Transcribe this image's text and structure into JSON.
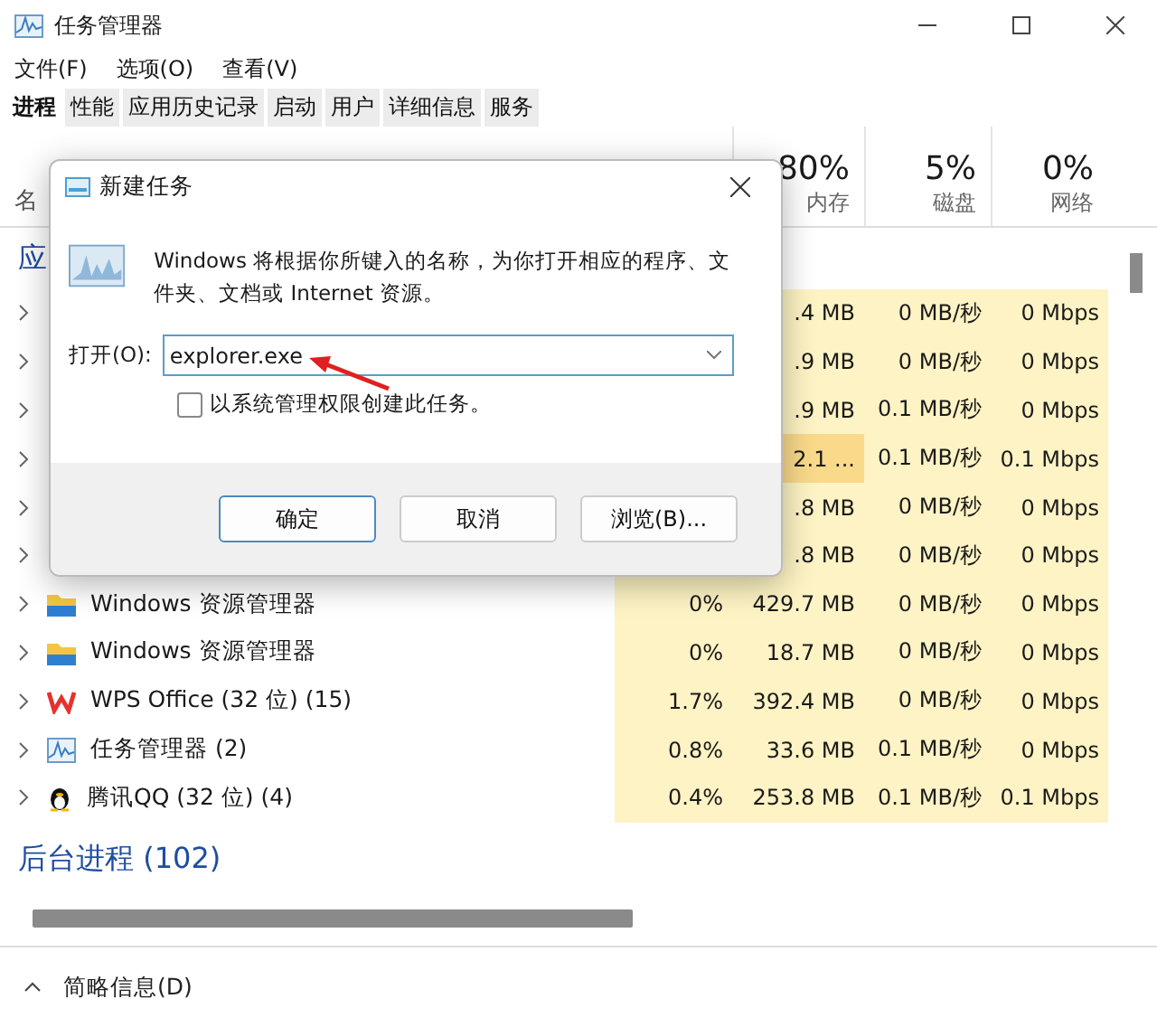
{
  "window": {
    "title": "任务管理器"
  },
  "menu": [
    "文件(F)",
    "选项(O)",
    "查看(V)"
  ],
  "tabs": [
    {
      "label": "进程",
      "selected": true
    },
    {
      "label": "性能",
      "selected": false
    },
    {
      "label": "应用历史记录",
      "selected": false
    },
    {
      "label": "启动",
      "selected": false
    },
    {
      "label": "用户",
      "selected": false
    },
    {
      "label": "详细信息",
      "selected": false
    },
    {
      "label": "服务",
      "selected": false
    }
  ],
  "table": {
    "name_header": "名",
    "columns": [
      {
        "percent": "80%",
        "label": "内存"
      },
      {
        "percent": "5%",
        "label": "磁盘"
      },
      {
        "percent": "0%",
        "label": "网络"
      }
    ],
    "group": "应",
    "rows": [
      {
        "memory": ".4 MB",
        "memory_hot": false,
        "disk": "0 MB/秒",
        "network": "0 Mbps"
      },
      {
        "memory": ".9 MB",
        "memory_hot": false,
        "disk": "0 MB/秒",
        "network": "0 Mbps"
      },
      {
        "memory": ".9 MB",
        "memory_hot": false,
        "disk": "0.1 MB/秒",
        "network": "0 Mbps"
      },
      {
        "memory": "2.1 ...",
        "memory_hot": true,
        "disk": "0.1 MB/秒",
        "network": "0.1 Mbps"
      },
      {
        "memory": ".8 MB",
        "memory_hot": false,
        "disk": "0 MB/秒",
        "network": "0 Mbps"
      },
      {
        "memory": ".8 MB",
        "memory_hot": false,
        "disk": "0 MB/秒",
        "network": "0 Mbps"
      },
      {
        "kind": "folder",
        "name": "Windows 资源管理器",
        "cpu": "0%",
        "memory": "429.7 MB",
        "memory_hot": false,
        "disk": "0 MB/秒",
        "network": "0 Mbps"
      },
      {
        "kind": "folder",
        "name": "Windows 资源管理器",
        "cpu": "0%",
        "memory": "18.7 MB",
        "memory_hot": false,
        "disk": "0 MB/秒",
        "network": "0 Mbps"
      },
      {
        "kind": "wps",
        "name": "WPS Office (32 位) (15)",
        "cpu": "1.7%",
        "memory": "392.4 MB",
        "memory_hot": false,
        "disk": "0 MB/秒",
        "network": "0 Mbps"
      },
      {
        "kind": "monitor",
        "name": "任务管理器 (2)",
        "cpu": "0.8%",
        "memory": "33.6 MB",
        "memory_hot": false,
        "disk": "0.1 MB/秒",
        "network": "0 Mbps"
      },
      {
        "kind": "penguin",
        "name": "腾讯QQ (32 位) (4)",
        "cpu": "0.4%",
        "memory": "253.8 MB",
        "memory_hot": false,
        "disk": "0.1 MB/秒",
        "network": "0.1 Mbps"
      }
    ],
    "background_group": "后台进程 (102)"
  },
  "footer": {
    "label": "简略信息(D)"
  },
  "dialog": {
    "title": "新建任务",
    "description": "Windows 将根据你所键入的名称，为你打开相应的程序、文件夹、文档或 Internet 资源。",
    "open_label": "打开(O):",
    "value": "explorer.exe",
    "checkbox": {
      "label": "以系统管理权限创建此任务。",
      "checked": false
    },
    "buttons": [
      {
        "label": "确定",
        "primary": true
      },
      {
        "label": "取消",
        "primary": false
      },
      {
        "label": "浏览(B)...",
        "primary": false
      }
    ]
  }
}
